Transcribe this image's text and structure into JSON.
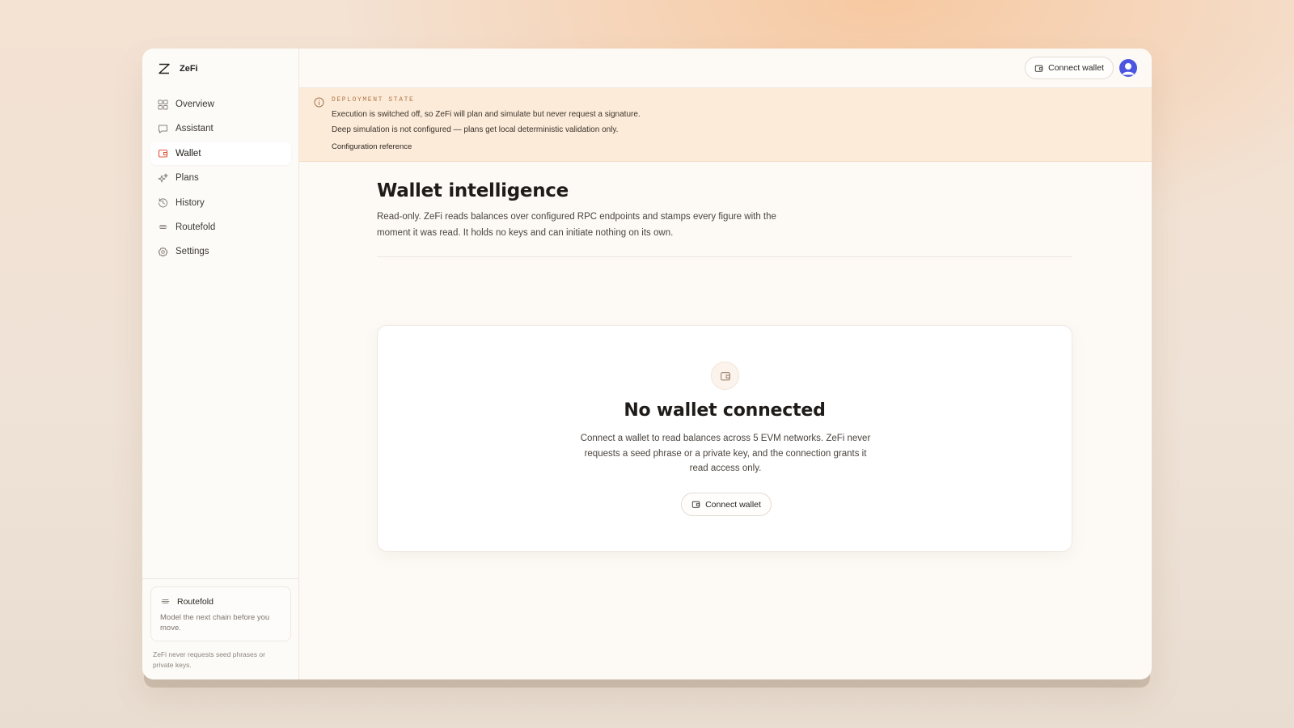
{
  "app": {
    "name": "ZeFi"
  },
  "sidebar": {
    "items": [
      {
        "label": "Overview",
        "icon": "grid-icon",
        "active": false
      },
      {
        "label": "Assistant",
        "icon": "chat-icon",
        "active": false
      },
      {
        "label": "Wallet",
        "icon": "wallet-icon",
        "active": true
      },
      {
        "label": "Plans",
        "icon": "sparkles-icon",
        "active": false
      },
      {
        "label": "History",
        "icon": "history-icon",
        "active": false
      },
      {
        "label": "Routefold",
        "icon": "routefold-icon",
        "active": false
      },
      {
        "label": "Settings",
        "icon": "gear-icon",
        "active": false
      }
    ],
    "promo": {
      "title": "Routefold",
      "description": "Model the next chain before you move."
    },
    "footnote": "ZeFi never requests seed phrases or private keys."
  },
  "topbar": {
    "connect_label": "Connect wallet"
  },
  "banner": {
    "kicker": "DEPLOYMENT STATE",
    "line1": "Execution is switched off, so ZeFi will plan and simulate but never request a signature.",
    "line2": "Deep simulation is not configured — plans get local deterministic validation only.",
    "link": "Configuration reference"
  },
  "page": {
    "title": "Wallet intelligence",
    "description": "Read-only. ZeFi reads balances over configured RPC endpoints and stamps every figure with the moment it was read. It holds no keys and can initiate nothing on its own."
  },
  "empty_state": {
    "title": "No wallet connected",
    "description": "Connect a wallet to read balances across 5 EVM networks. ZeFi never requests a seed phrase or a private key, and the connection grants it read access only.",
    "button_label": "Connect wallet"
  },
  "colors": {
    "accent": "#e0583b",
    "banner_bg": "#fcebd9",
    "avatar": "#4b55e0"
  }
}
